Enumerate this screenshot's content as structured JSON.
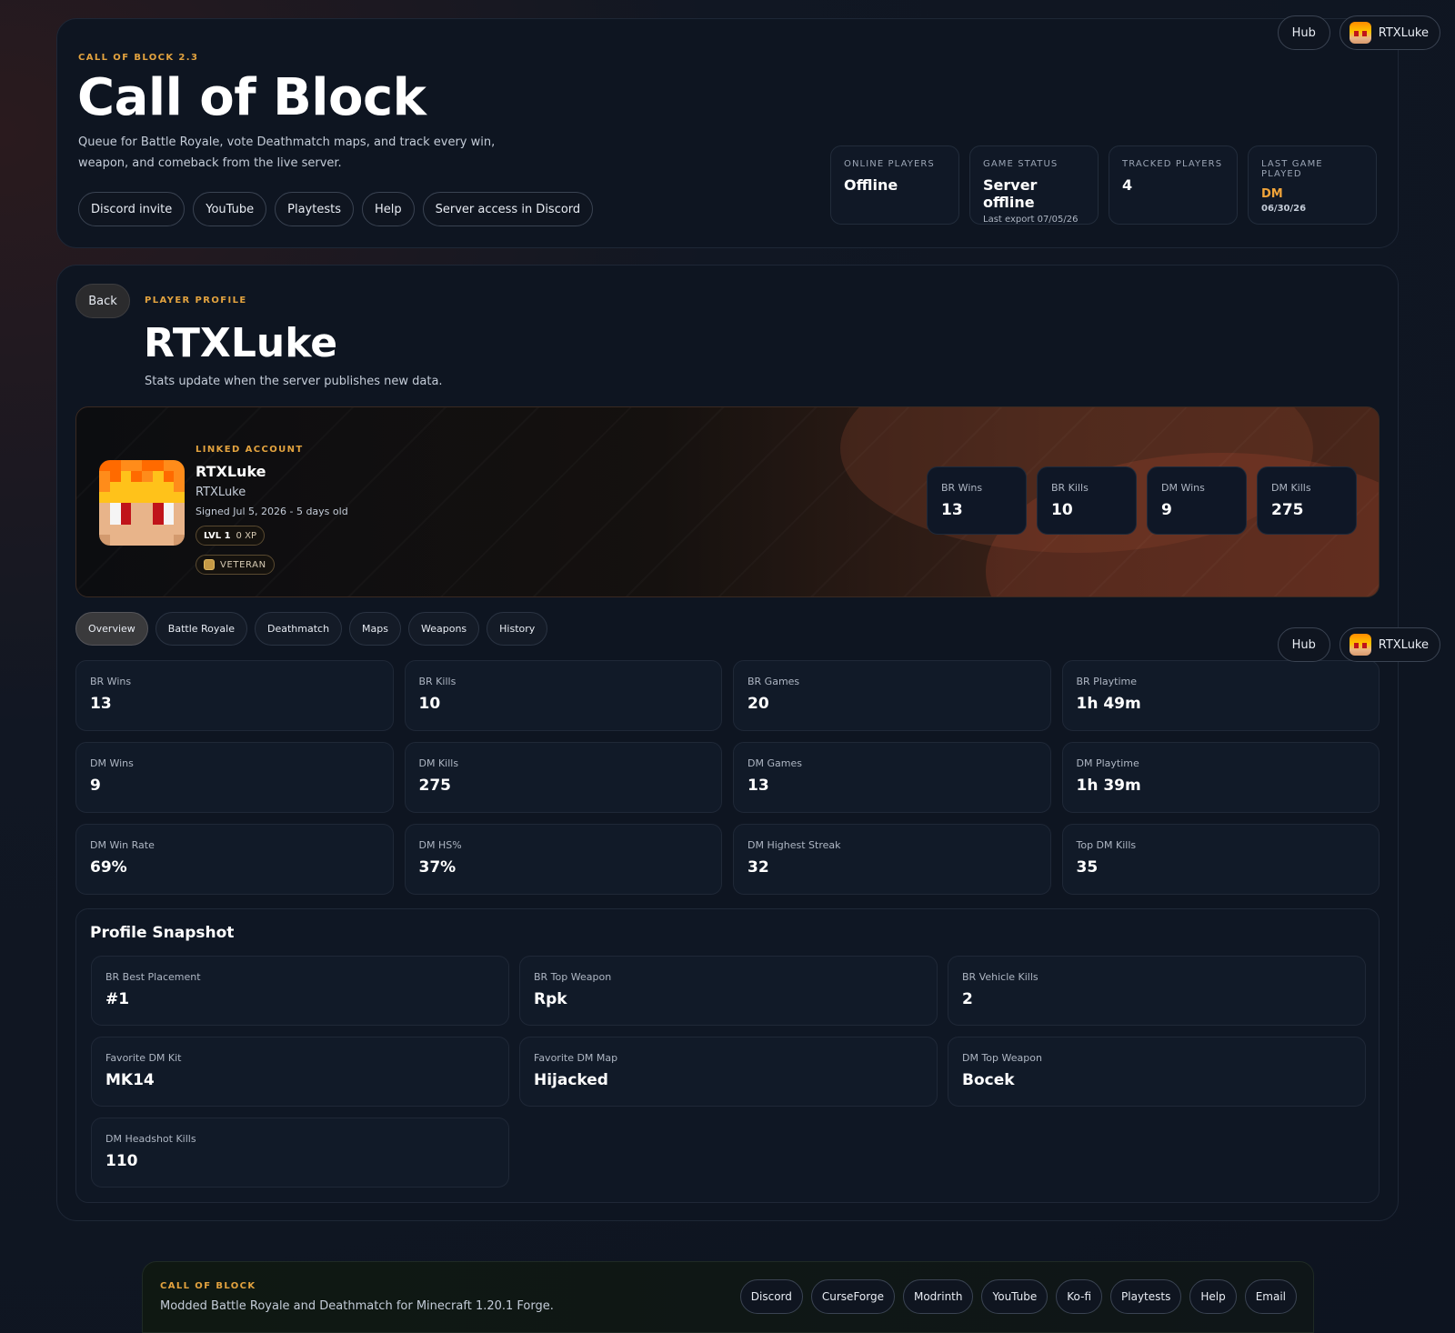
{
  "userbar": {
    "hub_label": "Hub",
    "username": "RTXLuke"
  },
  "header": {
    "eyebrow": "CALL OF BLOCK 2.3",
    "title": "Call of Block",
    "description": "Queue for Battle Royale, vote Deathmatch maps, and track every win, weapon, and comeback from the live server.",
    "links": [
      "Discord invite",
      "YouTube",
      "Playtests",
      "Help",
      "Server access in Discord"
    ],
    "stats": {
      "online": {
        "label": "ONLINE PLAYERS",
        "value": "Offline"
      },
      "status": {
        "label": "GAME STATUS",
        "value": "Server offline",
        "sub": "Last export 07/05/26"
      },
      "tracked": {
        "label": "TRACKED PLAYERS",
        "value": "4"
      },
      "last_game": {
        "label": "LAST GAME PLAYED",
        "value": "DM",
        "sub": "06/30/26"
      }
    }
  },
  "profile": {
    "back_label": "Back",
    "eyebrow": "PLAYER PROFILE",
    "name": "RTXLuke",
    "subtitle": "Stats update when the server publishes new data.",
    "linked": {
      "eyebrow": "LINKED ACCOUNT",
      "display_name": "RTXLuke",
      "username": "RTXLuke",
      "signed": "Signed Jul 5, 2026 - 5 days old",
      "level": "LVL 1",
      "xp": "0 XP",
      "rank": "VETERAN"
    },
    "banner_stats": [
      {
        "label": "BR Wins",
        "value": "13"
      },
      {
        "label": "BR Kills",
        "value": "10"
      },
      {
        "label": "DM Wins",
        "value": "9"
      },
      {
        "label": "DM Kills",
        "value": "275"
      }
    ]
  },
  "tabs": [
    "Overview",
    "Battle Royale",
    "Deathmatch",
    "Maps",
    "Weapons",
    "History"
  ],
  "stats_grid": [
    {
      "label": "BR Wins",
      "value": "13"
    },
    {
      "label": "BR Kills",
      "value": "10"
    },
    {
      "label": "BR Games",
      "value": "20"
    },
    {
      "label": "BR Playtime",
      "value": "1h 49m"
    },
    {
      "label": "DM Wins",
      "value": "9"
    },
    {
      "label": "DM Kills",
      "value": "275"
    },
    {
      "label": "DM Games",
      "value": "13"
    },
    {
      "label": "DM Playtime",
      "value": "1h 39m"
    },
    {
      "label": "DM Win Rate",
      "value": "69%"
    },
    {
      "label": "DM HS%",
      "value": "37%"
    },
    {
      "label": "DM Highest Streak",
      "value": "32"
    },
    {
      "label": "Top DM Kills",
      "value": "35"
    }
  ],
  "snapshot": {
    "title": "Profile Snapshot",
    "items": [
      {
        "label": "BR Best Placement",
        "value": "#1"
      },
      {
        "label": "BR Top Weapon",
        "value": "Rpk"
      },
      {
        "label": "BR Vehicle Kills",
        "value": "2"
      },
      {
        "label": "Favorite DM Kit",
        "value": "MK14"
      },
      {
        "label": "Favorite DM Map",
        "value": "Hijacked"
      },
      {
        "label": "DM Top Weapon",
        "value": "Bocek"
      },
      {
        "label": "DM Headshot Kills",
        "value": "110"
      }
    ]
  },
  "footer": {
    "eyebrow": "CALL OF BLOCK",
    "text": "Modded Battle Royale and Deathmatch for Minecraft 1.20.1 Forge.",
    "links": [
      "Discord",
      "CurseForge",
      "Modrinth",
      "YouTube",
      "Ko-fi",
      "Playtests",
      "Help",
      "Email"
    ]
  },
  "colors": {
    "accent": "#e3a33f",
    "background": "#0d1420",
    "card": "#111a28"
  }
}
